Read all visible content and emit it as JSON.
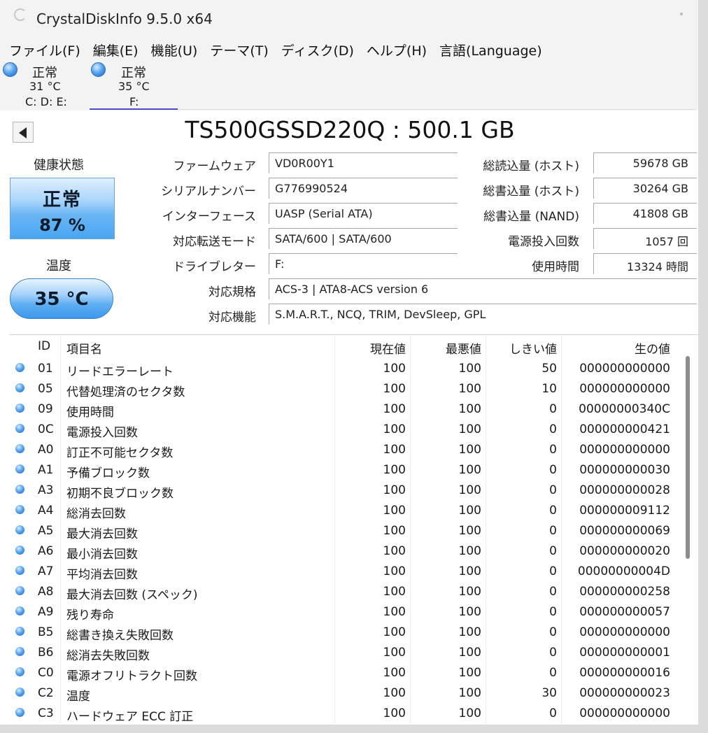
{
  "window": {
    "title": "CrystalDiskInfo 9.5.0 x64"
  },
  "menu": [
    {
      "label": "ファイル(F)"
    },
    {
      "label": "編集(E)"
    },
    {
      "label": "機能(U)"
    },
    {
      "label": "テーマ(T)"
    },
    {
      "label": "ディスク(D)"
    },
    {
      "label": "ヘルプ(H)"
    },
    {
      "label": "言語(Language)"
    }
  ],
  "disks": [
    {
      "status": "正常",
      "temp": "31 °C",
      "drives": "C: D: E:"
    },
    {
      "status": "正常",
      "temp": "35 °C",
      "drives": "F:"
    }
  ],
  "disk_title": "TS500GSSD220Q : 500.1 GB",
  "health": {
    "label": "健康状態",
    "status": "正常",
    "percent": "87 %"
  },
  "temperature": {
    "label": "温度",
    "value": "35 °C"
  },
  "info": {
    "firmware": {
      "label": "ファームウェア",
      "value": "VD0R00Y1"
    },
    "serial": {
      "label": "シリアルナンバー",
      "value": "G776990524"
    },
    "interface": {
      "label": "インターフェース",
      "value": "UASP (Serial ATA)"
    },
    "transfer": {
      "label": "対応転送モード",
      "value": "SATA/600 | SATA/600"
    },
    "drive_letter": {
      "label": "ドライブレター",
      "value": "F:"
    },
    "standard": {
      "label": "対応規格",
      "value": "ACS-3 | ATA8-ACS version 6"
    },
    "features": {
      "label": "対応機能",
      "value": "S.M.A.R.T., NCQ, TRIM, DevSleep, GPL"
    },
    "host_reads": {
      "label": "総読込量 (ホスト)",
      "value": "59678 GB"
    },
    "host_writes": {
      "label": "総書込量 (ホスト)",
      "value": "30264 GB"
    },
    "nand_writes": {
      "label": "総書込量 (NAND)",
      "value": "41808 GB"
    },
    "power_count": {
      "label": "電源投入回数",
      "value": "1057 回"
    },
    "power_hours": {
      "label": "使用時間",
      "value": "13324 時間"
    }
  },
  "smart": {
    "headers": {
      "id": "ID",
      "name": "項目名",
      "current": "現在値",
      "worst": "最悪値",
      "threshold": "しきい値",
      "raw": "生の値"
    },
    "rows": [
      {
        "id": "01",
        "name": "リードエラーレート",
        "current": "100",
        "worst": "100",
        "threshold": "50",
        "raw": "000000000000"
      },
      {
        "id": "05",
        "name": "代替処理済のセクタ数",
        "current": "100",
        "worst": "100",
        "threshold": "10",
        "raw": "000000000000"
      },
      {
        "id": "09",
        "name": "使用時間",
        "current": "100",
        "worst": "100",
        "threshold": "0",
        "raw": "00000000340C"
      },
      {
        "id": "0C",
        "name": "電源投入回数",
        "current": "100",
        "worst": "100",
        "threshold": "0",
        "raw": "000000000421"
      },
      {
        "id": "A0",
        "name": "訂正不可能セクタ数",
        "current": "100",
        "worst": "100",
        "threshold": "0",
        "raw": "000000000000"
      },
      {
        "id": "A1",
        "name": "予備ブロック数",
        "current": "100",
        "worst": "100",
        "threshold": "0",
        "raw": "000000000030"
      },
      {
        "id": "A3",
        "name": "初期不良ブロック数",
        "current": "100",
        "worst": "100",
        "threshold": "0",
        "raw": "000000000028"
      },
      {
        "id": "A4",
        "name": "総消去回数",
        "current": "100",
        "worst": "100",
        "threshold": "0",
        "raw": "000000009112"
      },
      {
        "id": "A5",
        "name": "最大消去回数",
        "current": "100",
        "worst": "100",
        "threshold": "0",
        "raw": "000000000069"
      },
      {
        "id": "A6",
        "name": "最小消去回数",
        "current": "100",
        "worst": "100",
        "threshold": "0",
        "raw": "000000000020"
      },
      {
        "id": "A7",
        "name": "平均消去回数",
        "current": "100",
        "worst": "100",
        "threshold": "0",
        "raw": "00000000004D"
      },
      {
        "id": "A8",
        "name": "最大消去回数 (スペック)",
        "current": "100",
        "worst": "100",
        "threshold": "0",
        "raw": "000000000258"
      },
      {
        "id": "A9",
        "name": "残り寿命",
        "current": "100",
        "worst": "100",
        "threshold": "0",
        "raw": "000000000057"
      },
      {
        "id": "B5",
        "name": "総書き換え失敗回数",
        "current": "100",
        "worst": "100",
        "threshold": "0",
        "raw": "000000000000"
      },
      {
        "id": "B6",
        "name": "総消去失敗回数",
        "current": "100",
        "worst": "100",
        "threshold": "0",
        "raw": "000000000001"
      },
      {
        "id": "C0",
        "name": "電源オフリトラクト回数",
        "current": "100",
        "worst": "100",
        "threshold": "0",
        "raw": "000000000016"
      },
      {
        "id": "C2",
        "name": "温度",
        "current": "100",
        "worst": "100",
        "threshold": "30",
        "raw": "000000000023"
      },
      {
        "id": "C3",
        "name": "ハードウェア ECC 訂正",
        "current": "100",
        "worst": "100",
        "threshold": "0",
        "raw": "000000000000"
      }
    ]
  }
}
